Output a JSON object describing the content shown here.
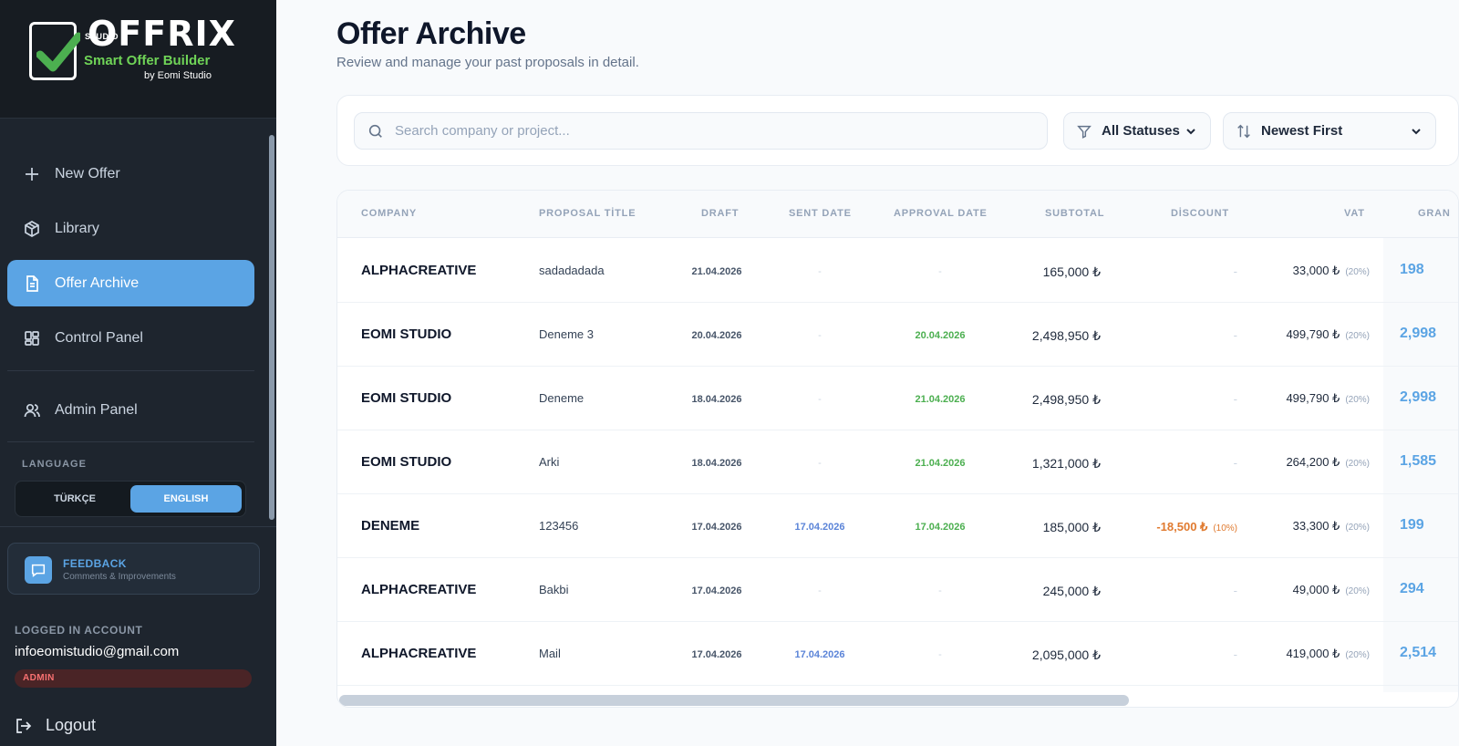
{
  "brand": {
    "studio": "STUDIO",
    "name": "OFFRIX",
    "tagline": "Smart Offer Builder",
    "by": "by Eomi Studio"
  },
  "sidebar": {
    "items": [
      {
        "label": "New Offer",
        "icon": "plus-icon"
      },
      {
        "label": "Library",
        "icon": "box-icon"
      },
      {
        "label": "Offer Archive",
        "icon": "document-icon",
        "active": true
      },
      {
        "label": "Control Panel",
        "icon": "grid-icon"
      },
      {
        "label": "Admin Panel",
        "icon": "users-icon"
      }
    ],
    "language_label": "LANGUAGE",
    "language_options": [
      "TÜRKÇE",
      "ENGLISH"
    ],
    "language_selected": "ENGLISH",
    "feedback": {
      "title": "FEEDBACK",
      "subtitle": "Comments & Improvements"
    },
    "account": {
      "label": "LOGGED IN ACCOUNT",
      "email": "infoeomistudio@gmail.com",
      "role": "ADMIN"
    },
    "logout": "Logout"
  },
  "header": {
    "title": "Offer Archive",
    "subtitle": "Review and manage your past proposals in detail."
  },
  "filters": {
    "search_placeholder": "Search company or project...",
    "status_value": "All Statuses",
    "sort_value": "Newest First"
  },
  "table": {
    "columns": [
      "COMPANY",
      "PROPOSAL TİTLE",
      "DRAFT",
      "SENT DATE",
      "APPROVAL DATE",
      "SUBTOTAL",
      "DİSCOUNT",
      "VAT",
      "GRAN"
    ],
    "rows": [
      {
        "company": "ALPHACREATIVE",
        "title": "sadadadada",
        "draft": "21.04.2026",
        "sent": "-",
        "approval": "-",
        "subtotal": "165,000 ₺",
        "discount": "-",
        "discount_pct": "",
        "vat": "33,000 ₺",
        "vat_pct": "(20%)",
        "grand": "198"
      },
      {
        "company": "EOMI STUDIO",
        "title": "Deneme 3",
        "draft": "20.04.2026",
        "sent": "-",
        "approval": "20.04.2026",
        "subtotal": "2,498,950 ₺",
        "discount": "-",
        "discount_pct": "",
        "vat": "499,790 ₺",
        "vat_pct": "(20%)",
        "grand": "2,998"
      },
      {
        "company": "EOMI STUDIO",
        "title": "Deneme",
        "draft": "18.04.2026",
        "sent": "-",
        "approval": "21.04.2026",
        "subtotal": "2,498,950 ₺",
        "discount": "-",
        "discount_pct": "",
        "vat": "499,790 ₺",
        "vat_pct": "(20%)",
        "grand": "2,998"
      },
      {
        "company": "EOMI STUDIO",
        "title": "Arki",
        "draft": "18.04.2026",
        "sent": "-",
        "approval": "21.04.2026",
        "subtotal": "1,321,000 ₺",
        "discount": "-",
        "discount_pct": "",
        "vat": "264,200 ₺",
        "vat_pct": "(20%)",
        "grand": "1,585"
      },
      {
        "company": "DENEME",
        "title": "123456",
        "draft": "17.04.2026",
        "sent": "17.04.2026",
        "approval": "17.04.2026",
        "subtotal": "185,000 ₺",
        "discount": "-18,500 ₺",
        "discount_pct": "(10%)",
        "vat": "33,300 ₺",
        "vat_pct": "(20%)",
        "grand": "199"
      },
      {
        "company": "ALPHACREATIVE",
        "title": "Bakbi",
        "draft": "17.04.2026",
        "sent": "-",
        "approval": "-",
        "subtotal": "245,000 ₺",
        "discount": "-",
        "discount_pct": "",
        "vat": "49,000 ₺",
        "vat_pct": "(20%)",
        "grand": "294"
      },
      {
        "company": "ALPHACREATIVE",
        "title": "Mail",
        "draft": "17.04.2026",
        "sent": "17.04.2026",
        "approval": "-",
        "subtotal": "2,095,000 ₺",
        "discount": "-",
        "discount_pct": "",
        "vat": "419,000 ₺",
        "vat_pct": "(20%)",
        "grand": "2,514"
      }
    ]
  },
  "colors": {
    "accent": "#5ba4e4",
    "sidebar_bg": "#1e252e",
    "approval_green": "#4caf50",
    "sent_blue": "#5b84d8",
    "discount_orange": "#e07a2f",
    "admin_red": "#f87171"
  }
}
